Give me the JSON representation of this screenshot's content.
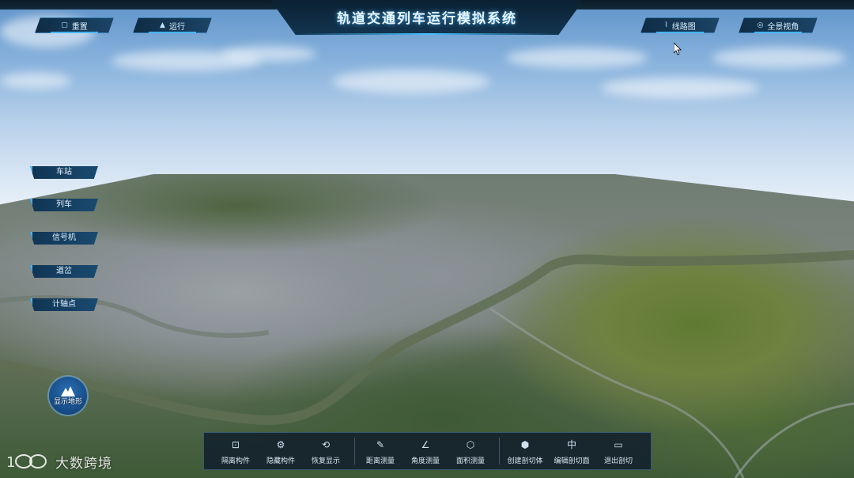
{
  "header": {
    "title": "轨道交通列车运行模拟系统"
  },
  "top_buttons": [
    {
      "label": "重置",
      "icon": "reset-icon"
    },
    {
      "label": "运行",
      "icon": "run-icon"
    },
    {
      "label": "线路图",
      "icon": "line-chart-icon"
    },
    {
      "label": "全景视角",
      "icon": "panorama-icon"
    }
  ],
  "side_menu": [
    {
      "label": "车站"
    },
    {
      "label": "列车"
    },
    {
      "label": "信号机"
    },
    {
      "label": "道岔"
    },
    {
      "label": "计轴点"
    }
  ],
  "terrain_toggle": {
    "label": "显示地形",
    "icon": "mountain-icon"
  },
  "toolbar": {
    "groups": [
      [
        {
          "label": "隔离构件",
          "icon": "isolate-icon"
        },
        {
          "label": "隐藏构件",
          "icon": "hide-icon"
        },
        {
          "label": "恢复显示",
          "icon": "restore-icon"
        }
      ],
      [
        {
          "label": "距离测量",
          "icon": "ruler-icon"
        },
        {
          "label": "角度测量",
          "icon": "angle-icon"
        },
        {
          "label": "面积测量",
          "icon": "area-icon"
        }
      ],
      [
        {
          "label": "创建剖切体",
          "icon": "cube-icon"
        },
        {
          "label": "编辑剖切面",
          "icon": "section-edit-icon"
        },
        {
          "label": "退出剖切",
          "icon": "exit-section-icon"
        }
      ]
    ]
  },
  "watermark": {
    "text": "大数跨境"
  },
  "colors": {
    "accent": "#46b6ff",
    "panel": "#0f2c45",
    "toolbar_bg": "#12202c"
  }
}
